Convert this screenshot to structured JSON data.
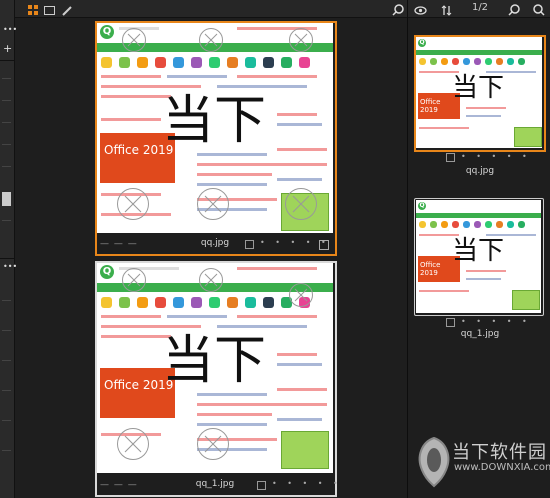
{
  "toolbar": {
    "tools": [
      "grid-view-icon",
      "single-view-icon",
      "pen-icon",
      "zoom-icon"
    ],
    "right_tools": [
      "eye-icon",
      "sort-icon",
      "zoom-icon",
      "search-icon"
    ],
    "page_counter": "1/2"
  },
  "main": {
    "items": [
      {
        "filename": "qq.jpg",
        "dashes": "— — —",
        "dots": "• • • • •"
      },
      {
        "filename": "qq_1.jpg",
        "dashes": "— — —",
        "dots": "• • • • •"
      }
    ]
  },
  "side": {
    "items": [
      {
        "filename": "qq.jpg",
        "dots": "• • • • •"
      },
      {
        "filename": "qq_1.jpg",
        "dots": "• • • • •"
      }
    ]
  },
  "thumb": {
    "big_text": "当下",
    "office_text": "Office 2019"
  },
  "brand": {
    "cn": "当下软件园",
    "en": "www.DOWNXIA.com"
  },
  "colors": {
    "selected_border": "#e8861a",
    "accent_green": "#3bae4c",
    "office_red": "#e0491c"
  }
}
